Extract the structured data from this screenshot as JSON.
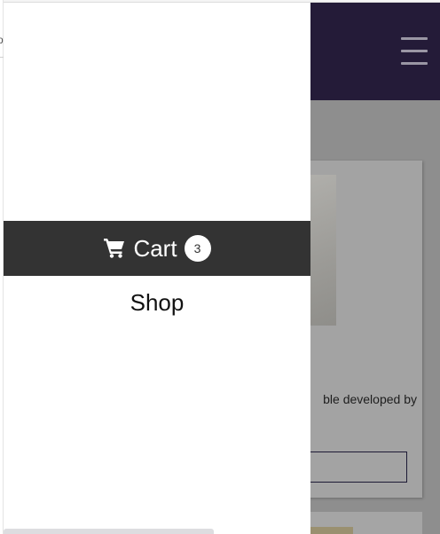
{
  "left_edge": {
    "glyph": "p"
  },
  "header": {
    "menu_icon": "hamburger-icon",
    "background": "#241b38"
  },
  "product": {
    "description_fragment": "ble developed by"
  },
  "drawer": {
    "cart": {
      "icon": "shopping-cart-icon",
      "label": "Cart",
      "count": "3",
      "background": "#333333"
    },
    "shop_label": "Shop"
  }
}
